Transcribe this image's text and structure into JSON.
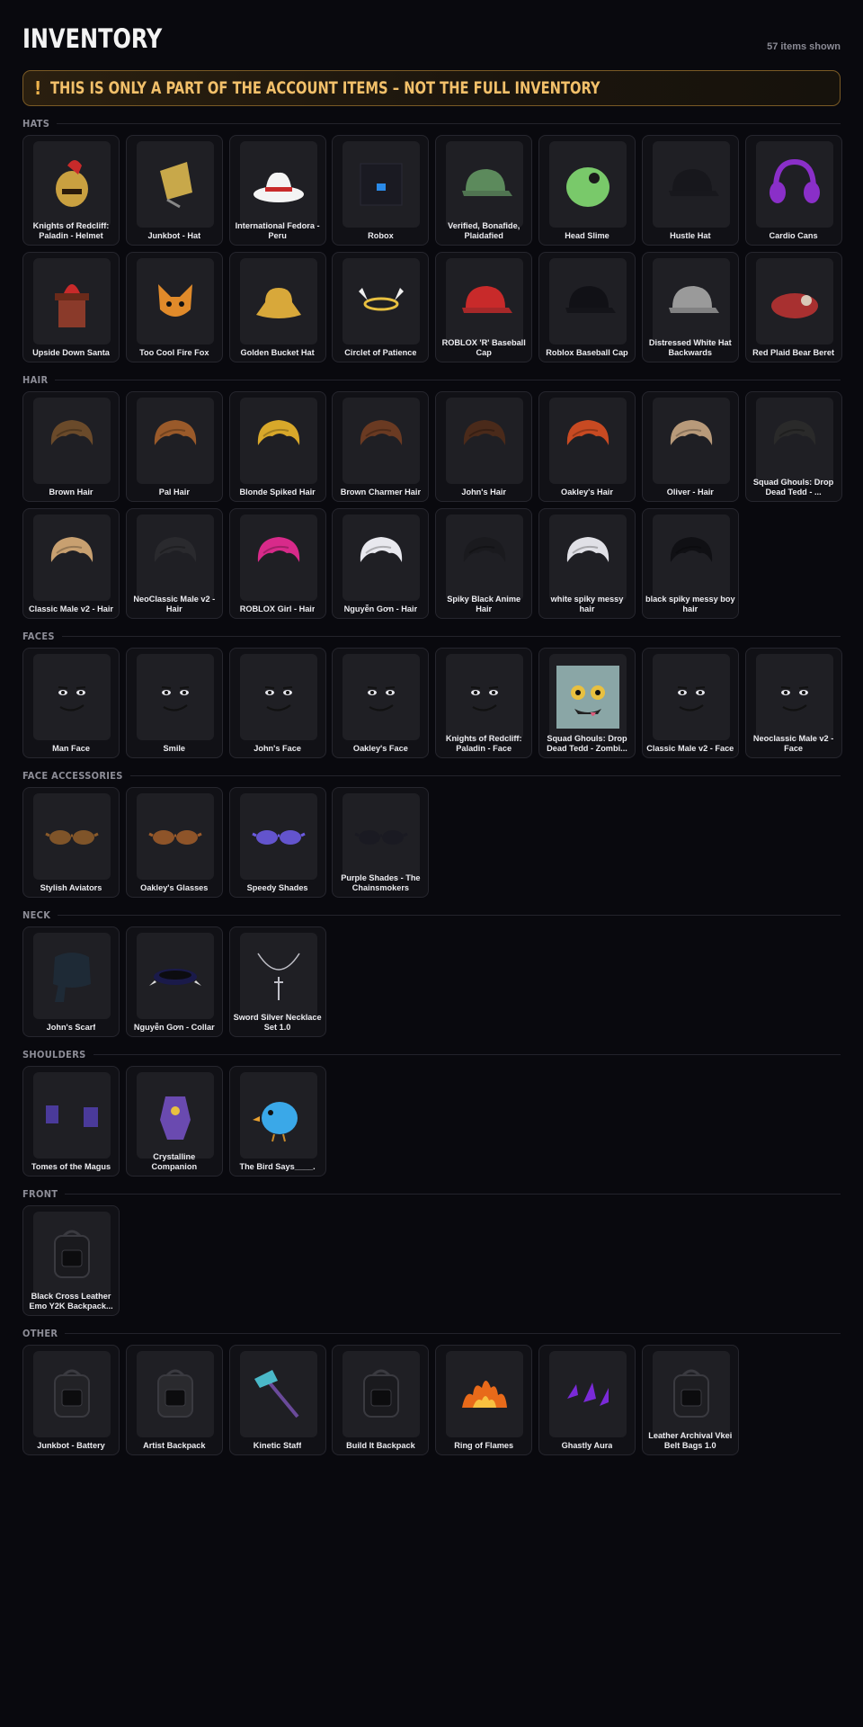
{
  "title": "INVENTORY",
  "items_shown": "57 items shown",
  "banner": {
    "icon": "!",
    "text": "THIS IS ONLY A PART OF THE ACCOUNT ITEMS – NOT THE FULL INVENTORY"
  },
  "sections": [
    {
      "title": "HATS",
      "items": [
        {
          "name": "Knights of Redcliff: Paladin - Helmet",
          "icon": "helmet-icon",
          "color": "#c9a040"
        },
        {
          "name": "Junkbot - Hat",
          "icon": "hat-icon",
          "color": "#c8a84a"
        },
        {
          "name": "International Fedora - Peru",
          "icon": "fedora-icon",
          "color": "#f4f4f4"
        },
        {
          "name": "Robox",
          "icon": "box-icon",
          "color": "#1a1a22"
        },
        {
          "name": "Verified, Bonafide, Plaidafied",
          "icon": "cap-icon",
          "color": "#5c8a5c"
        },
        {
          "name": "Head Slime",
          "icon": "slime-icon",
          "color": "#79c96a"
        },
        {
          "name": "Hustle Hat",
          "icon": "cap-icon",
          "color": "#17171c"
        },
        {
          "name": "Cardio Cans",
          "icon": "headphones-icon",
          "color": "#8a2fc8"
        },
        {
          "name": "Upside Down Santa",
          "icon": "chimney-icon",
          "color": "#8a3a2a"
        },
        {
          "name": "Too Cool Fire Fox",
          "icon": "fox-icon",
          "color": "#e08a2a"
        },
        {
          "name": "Golden Bucket Hat",
          "icon": "bucket-hat-icon",
          "color": "#d8a83a"
        },
        {
          "name": "Circlet of Patience",
          "icon": "circlet-icon",
          "color": "#e8c040"
        },
        {
          "name": "ROBLOX 'R' Baseball Cap",
          "icon": "cap-icon",
          "color": "#c82a2a"
        },
        {
          "name": "Roblox Baseball Cap",
          "icon": "cap-icon",
          "color": "#111116"
        },
        {
          "name": "Distressed White Hat Backwards",
          "icon": "cap-icon",
          "color": "#9a9a9a"
        },
        {
          "name": "Red Plaid Bear Beret",
          "icon": "beret-icon",
          "color": "#a83030"
        }
      ]
    },
    {
      "title": "HAIR",
      "items": [
        {
          "name": "Brown Hair",
          "icon": "hair-icon",
          "color": "#6a4a2a"
        },
        {
          "name": "Pal Hair",
          "icon": "hair-icon",
          "color": "#9a5a2a"
        },
        {
          "name": "Blonde Spiked Hair",
          "icon": "hair-icon",
          "color": "#d8a82a"
        },
        {
          "name": "Brown Charmer Hair",
          "icon": "hair-icon",
          "color": "#6a3a22"
        },
        {
          "name": "John's Hair",
          "icon": "hair-icon",
          "color": "#4a2a1a"
        },
        {
          "name": "Oakley's Hair",
          "icon": "hair-icon",
          "color": "#c84a22"
        },
        {
          "name": "Oliver - Hair",
          "icon": "hair-icon",
          "color": "#b89a7a"
        },
        {
          "name": "Squad Ghouls: Drop Dead Tedd - ...",
          "icon": "hair-icon",
          "color": "#2a2a2a"
        },
        {
          "name": "Classic Male v2 - Hair",
          "icon": "hair-icon",
          "color": "#c8a070"
        },
        {
          "name": "NeoClassic Male v2 - Hair",
          "icon": "hair-icon",
          "color": "#2a2a2e"
        },
        {
          "name": "ROBLOX Girl - Hair",
          "icon": "hair-icon",
          "color": "#d82a8a"
        },
        {
          "name": "Nguyễn Gơn - Hair",
          "icon": "hair-icon",
          "color": "#e8e8ee"
        },
        {
          "name": "Spiky Black Anime Hair",
          "icon": "hair-icon",
          "color": "#1a1a1e"
        },
        {
          "name": "white spiky messy hair",
          "icon": "hair-icon",
          "color": "#e0e0e6"
        },
        {
          "name": "black spiky messy boy hair",
          "icon": "hair-icon",
          "color": "#101014"
        }
      ]
    },
    {
      "title": "FACES",
      "items": [
        {
          "name": "Man Face",
          "icon": "face-icon",
          "color": "#0e0e10"
        },
        {
          "name": "Smile",
          "icon": "face-icon",
          "color": "#0e0e10"
        },
        {
          "name": "John's Face",
          "icon": "face-icon",
          "color": "#0e0e10"
        },
        {
          "name": "Oakley's Face",
          "icon": "face-icon",
          "color": "#0e0e10"
        },
        {
          "name": "Knights of Redcliff: Paladin - Face",
          "icon": "face-icon",
          "color": "#c82a2a"
        },
        {
          "name": "Squad Ghouls: Drop Dead Tedd - Zombi...",
          "icon": "zombie-face-icon",
          "color": "#7a9a9a"
        },
        {
          "name": "Classic Male v2 - Face",
          "icon": "face-icon",
          "color": "#0e0e10"
        },
        {
          "name": "Neoclassic Male v2 - Face",
          "icon": "face-icon",
          "color": "#0e0e10"
        }
      ]
    },
    {
      "title": "FACE ACCESSORIES",
      "items": [
        {
          "name": "Stylish Aviators",
          "icon": "glasses-icon",
          "color": "#8a5a2a"
        },
        {
          "name": "Oakley's Glasses",
          "icon": "glasses-icon",
          "color": "#9a5a2a"
        },
        {
          "name": "Speedy Shades",
          "icon": "glasses-icon",
          "color": "#6a5ae0"
        },
        {
          "name": "Purple Shades - The Chainsmokers",
          "icon": "glasses-icon",
          "color": "#1a1a22"
        }
      ]
    },
    {
      "title": "NECK",
      "items": [
        {
          "name": "John's Scarf",
          "icon": "scarf-icon",
          "color": "#1e2a36"
        },
        {
          "name": "Nguyễn Gơn - Collar",
          "icon": "collar-icon",
          "color": "#1a1a4a"
        },
        {
          "name": "Sword Silver Necklace Set 1.0",
          "icon": "necklace-icon",
          "color": "#c0c0c8"
        }
      ]
    },
    {
      "title": "SHOULDERS",
      "items": [
        {
          "name": "Tomes of the Magus",
          "icon": "book-icon",
          "color": "#4a3a9a"
        },
        {
          "name": "Crystalline Companion",
          "icon": "companion-icon",
          "color": "#6a4ab0"
        },
        {
          "name": "The Bird Says____.",
          "icon": "bird-icon",
          "color": "#3aa8e8"
        }
      ]
    },
    {
      "title": "FRONT",
      "items": [
        {
          "name": "Black Cross Leather Emo Y2K Backpack...",
          "icon": "backpack-icon",
          "color": "#1a1a1e"
        }
      ]
    },
    {
      "title": "OTHER",
      "items": [
        {
          "name": "Junkbot - Battery",
          "icon": "battery-icon",
          "color": "#222226"
        },
        {
          "name": "Artist Backpack",
          "icon": "backpack-icon",
          "color": "#2a2a2e"
        },
        {
          "name": "Kinetic Staff",
          "icon": "staff-icon",
          "color": "#4ab8c8"
        },
        {
          "name": "Build It Backpack",
          "icon": "backpack-icon",
          "color": "#1a1a1e"
        },
        {
          "name": "Ring of Flames",
          "icon": "flames-icon",
          "color": "#e86a1a"
        },
        {
          "name": "Ghastly Aura",
          "icon": "aura-icon",
          "color": "#7a2ad8"
        },
        {
          "name": "Leather Archival Vkei Belt Bags 1.0",
          "icon": "bag-icon",
          "color": "#1e1e22"
        }
      ]
    }
  ]
}
